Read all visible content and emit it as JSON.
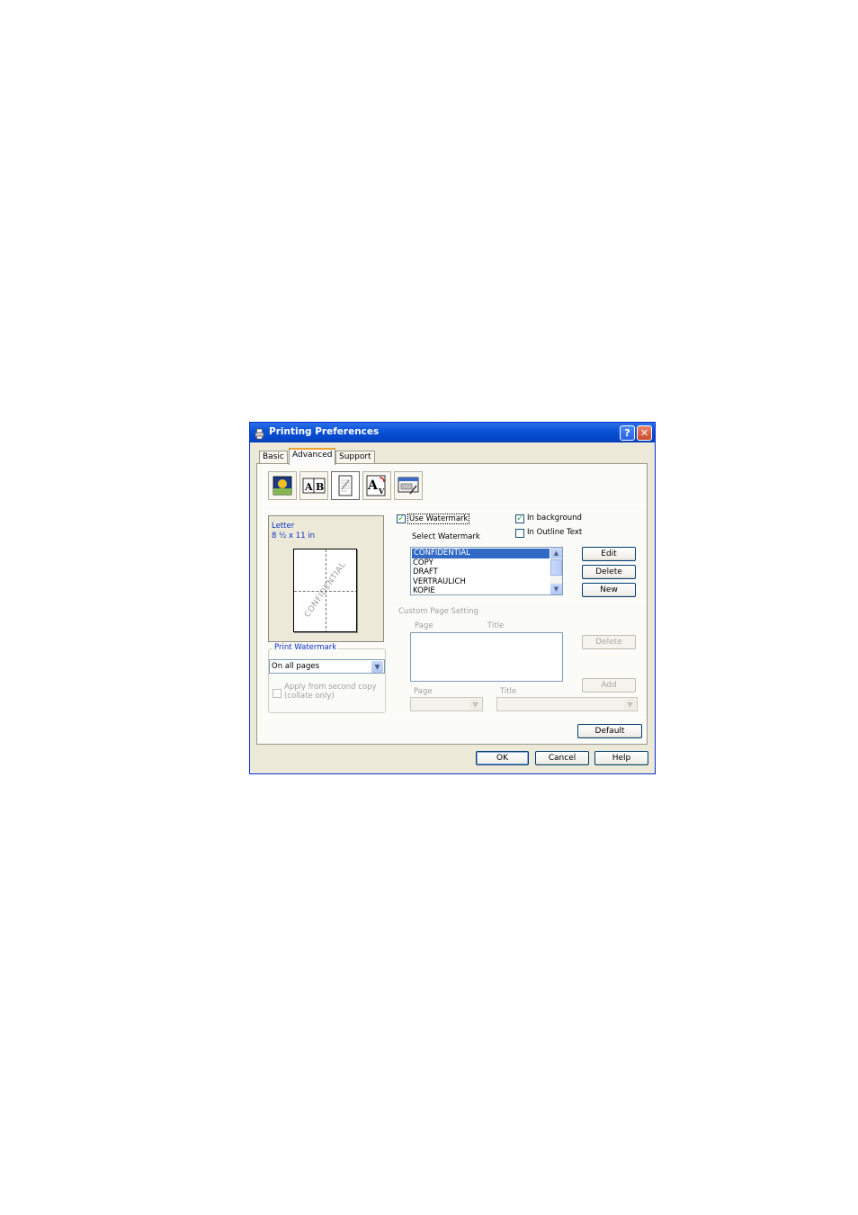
{
  "window": {
    "title": "Printing Preferences",
    "help_glyph": "?",
    "close_glyph": "✕"
  },
  "tabs": [
    {
      "label": "Basic"
    },
    {
      "label": "Advanced"
    },
    {
      "label": "Support"
    }
  ],
  "toolbar_icons": [
    "color-quality-icon",
    "duplex-ab-icon",
    "watermark-icon",
    "font-substitution-icon",
    "device-options-icon"
  ],
  "preview": {
    "paper_name": "Letter",
    "paper_size": "8 ½ x 11 in",
    "watermark_text": "CONFIDENTIAL"
  },
  "watermark": {
    "use_label": "Use Watermark",
    "use_checked": true,
    "background_label": "In background",
    "background_checked": true,
    "outline_label": "In Outline Text",
    "outline_checked": false,
    "select_label": "Select Watermark",
    "items": [
      "CONFIDENTIAL",
      "COPY",
      "DRAFT",
      "VERTRAULICH",
      "KOPIE"
    ],
    "selected_index": 0,
    "edit_label": "Edit",
    "delete_label": "Delete",
    "new_label": "New"
  },
  "print_watermark": {
    "group_label": "Print Watermark",
    "selected": "On all pages",
    "apply_label": "Apply from second copy",
    "collate_label": "(collate only)"
  },
  "custom_page": {
    "group_label": "Custom Page Setting",
    "page_header": "Page",
    "title_header": "Title",
    "delete_label": "Delete",
    "add_label": "Add",
    "page_label": "Page",
    "title_label": "Title"
  },
  "default_label": "Default",
  "footer": {
    "ok": "OK",
    "cancel": "Cancel",
    "help": "Help"
  }
}
